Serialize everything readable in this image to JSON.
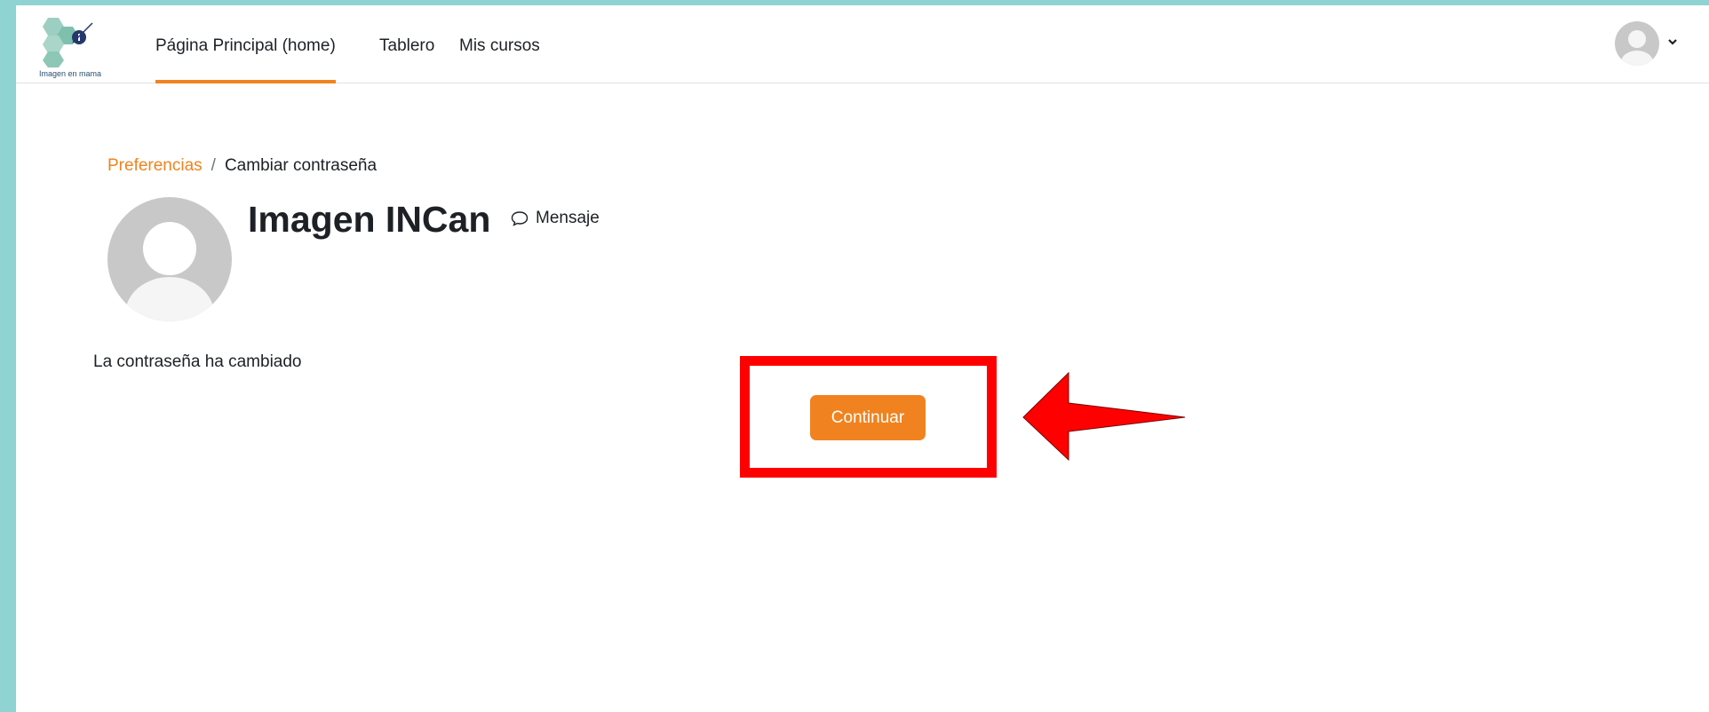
{
  "header": {
    "logo_text": "Imagen en mama",
    "nav": [
      {
        "label": "Página Principal (home)",
        "active": true
      },
      {
        "label": "Tablero",
        "active": false
      },
      {
        "label": "Mis cursos",
        "active": false
      }
    ]
  },
  "breadcrumb": {
    "parent": "Preferencias",
    "separator": "/",
    "current": "Cambiar contraseña"
  },
  "profile": {
    "name": "Imagen INCan",
    "message_label": "Mensaje"
  },
  "main": {
    "status_message": "La contraseña ha cambiado",
    "continue_label": "Continuar"
  },
  "colors": {
    "accent": "#f0831f",
    "frame": "#8fd3d2",
    "highlight": "#ff0000"
  },
  "icons": {
    "message": "speech-bubble-icon",
    "user_menu": "user-avatar-icon",
    "caret": "chevron-down-icon"
  }
}
